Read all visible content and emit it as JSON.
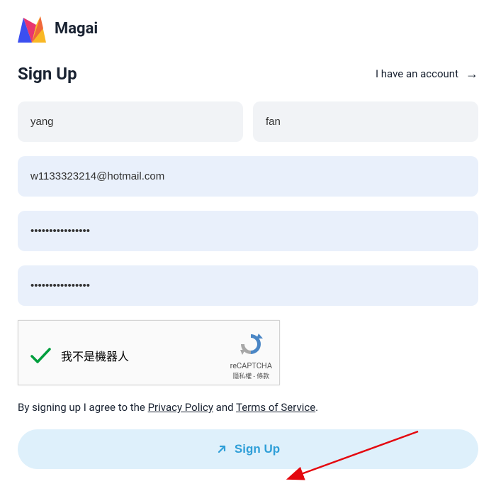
{
  "brand": "Magai",
  "title": "Sign Up",
  "haveAccount": "I have an account",
  "form": {
    "firstName": "yang",
    "lastName": "fan",
    "email": "w1133323214@hotmail.com",
    "password": "••••••••••••••••",
    "confirmPassword": "••••••••••••••••"
  },
  "captcha": {
    "text": "我不是機器人",
    "brand": "reCAPTCHA",
    "links": "隱私權 - 條款"
  },
  "agree": {
    "prefix": "By signing up I agree to the ",
    "privacy": "Privacy Policy",
    "mid": " and ",
    "tos": "Terms of Service",
    "suffix": "."
  },
  "submitLabel": "Sign Up"
}
